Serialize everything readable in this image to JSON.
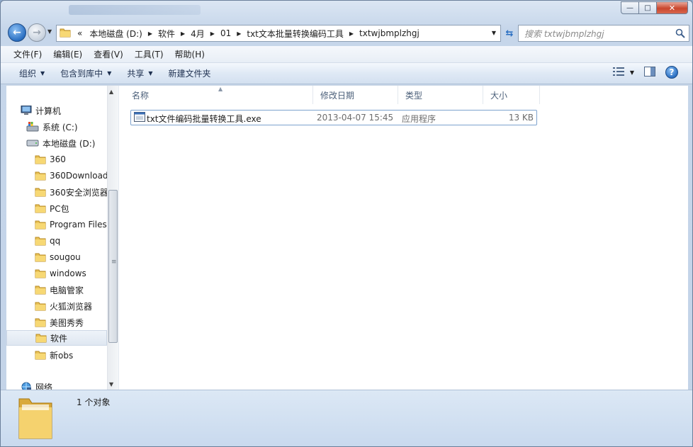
{
  "window": {
    "minimize": "—",
    "maximize": "□",
    "close": "✕"
  },
  "address": {
    "overflow": "«",
    "crumbs": [
      "本地磁盘 (D:)",
      "软件",
      "4月",
      "01",
      "txt文本批量转换编码工具",
      "txtwjbmplzhgj"
    ]
  },
  "search": {
    "placeholder": "搜索 txtwjbmplzhgj"
  },
  "menu": [
    "文件(F)",
    "编辑(E)",
    "查看(V)",
    "工具(T)",
    "帮助(H)"
  ],
  "commands": {
    "organize": "组织",
    "include_in_library": "包含到库中",
    "share": "共享",
    "new_folder": "新建文件夹"
  },
  "tree": {
    "computer": "计算机",
    "drive_c": "系统 (C:)",
    "drive_d": "本地磁盘 (D:)",
    "folders": [
      "360",
      "360Download",
      "360安全浏览器",
      "PC包",
      "Program Files",
      "qq",
      "sougou",
      "windows",
      "电脑管家",
      "火狐浏览器",
      "美图秀秀",
      "软件",
      "新obs"
    ],
    "selected": "软件",
    "network": "网络"
  },
  "columns": {
    "name": "名称",
    "modified": "修改日期",
    "type": "类型",
    "size": "大小"
  },
  "files": [
    {
      "name": "txt文件编码批量转换工具.exe",
      "modified": "2013-04-07 15:45",
      "type": "应用程序",
      "size": "13 KB"
    }
  ],
  "status": {
    "count": "1 个对象"
  },
  "colors": {
    "selection_border": "#7da2ce",
    "header_text": "#4c607a",
    "chrome": "#c6d6ea"
  }
}
